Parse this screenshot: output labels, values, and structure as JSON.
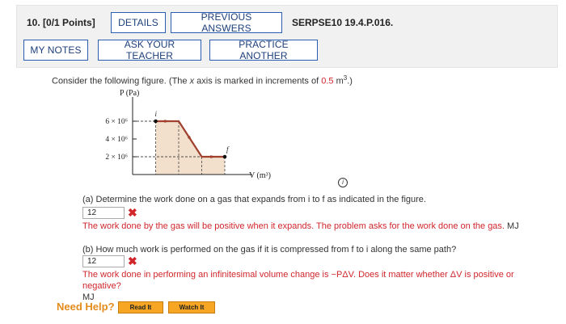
{
  "header": {
    "question_number": "10.",
    "points": "[0/1 Points]",
    "details_label": "DETAILS",
    "previous_answers_label": "PREVIOUS ANSWERS",
    "problem_code": "SERPSE10 19.4.P.016.",
    "my_notes_label": "MY NOTES",
    "ask_teacher_label": "ASK YOUR TEACHER",
    "practice_another_label": "PRACTICE ANOTHER"
  },
  "prompt": {
    "before": "Consider the following figure. (The ",
    "x_var": "x",
    "middle": " axis is marked in increments of ",
    "increment": "0.5",
    "unit": " m",
    "unit_exp": "3",
    "after": ".)"
  },
  "figure": {
    "y_axis_label": "P (Pa)",
    "x_axis_label": "V (m³)",
    "y_ticks": [
      {
        "text": "6 × 10⁶",
        "value": 6
      },
      {
        "text": "4 × 10⁶",
        "value": 4
      },
      {
        "text": "2 × 10⁶",
        "value": 2
      }
    ],
    "point_i_label": "i",
    "point_f_label": "f",
    "path": [
      {
        "v": 0.5,
        "p": 6
      },
      {
        "v": 1.0,
        "p": 6
      },
      {
        "v": 1.5,
        "p": 2
      },
      {
        "v": 2.0,
        "p": 2
      }
    ],
    "colors": {
      "path": "#a0402f",
      "fill": "#f2e0cc"
    }
  },
  "part_a": {
    "question": "(a) Determine the work done on a gas that expands from i to f as indicated in the figure.",
    "answer": "12",
    "feedback": "The work done by the gas will be positive when it expands. The problem asks for the work done on the gas.",
    "feedback_suffix": "MJ"
  },
  "part_b": {
    "question": "(b) How much work is performed on the gas if it is compressed from f to i along the same path?",
    "answer": "12",
    "feedback": "The work done in performing an infinitesimal volume change is −PΔV. Does it matter whether ΔV is positive or negative?",
    "feedback_suffix": "MJ"
  },
  "help": {
    "label": "Need Help?",
    "read_it": "Read It",
    "watch_it": "Watch It"
  },
  "colors": {
    "accent": "#2a5db0",
    "error": "#d0262c",
    "help": "#e38b1b",
    "help_button": "#f6a623"
  }
}
